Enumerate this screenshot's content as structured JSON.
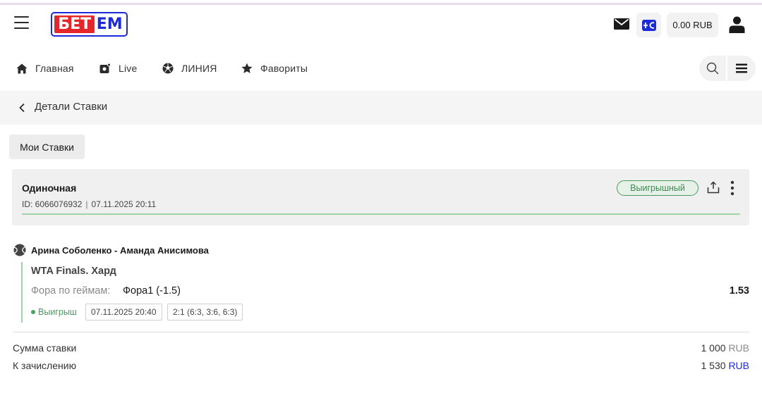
{
  "header": {
    "logo_left": "БЕТ",
    "logo_right": "ЕМ",
    "balance": "0.00 RUB"
  },
  "nav": {
    "items": [
      {
        "label": "Главная",
        "icon": "home-icon"
      },
      {
        "label": "Live",
        "icon": "live-icon"
      },
      {
        "label": "ЛИНИЯ",
        "icon": "soccer-ball-icon"
      },
      {
        "label": "Фавориты",
        "icon": "star-icon"
      }
    ]
  },
  "subheader": {
    "title": "Детали Ставки"
  },
  "my_bets_label": "Мои Ставки",
  "bet": {
    "type": "Одиночная",
    "id_text": "ID: 6066076932",
    "datetime": "07.11.2025 20:11",
    "status": "Выигрышный",
    "status_color": "#3f8a52"
  },
  "event": {
    "sport_icon": "tennis-ball-icon",
    "title": "Арина Соболенко - Аманда Анисимова",
    "tournament": "WTA Finals. Хард",
    "market_label": "Фора по геймам:",
    "market_value": "Фора1 (-1.5)",
    "odds": "1.53",
    "result": "Выигрыш",
    "event_datetime": "07.11.2025 20:40",
    "score": "2:1 (6:3, 3:6, 6:3)"
  },
  "summary": {
    "stake_label": "Сумма ставки",
    "stake_amount": "1 000",
    "stake_currency": "RUB",
    "payout_label": "К зачислению",
    "payout_amount": "1 530",
    "payout_currency": "RUB"
  },
  "colors": {
    "brand_red": "#e5262b",
    "brand_blue": "#1d2ad8",
    "win_green": "#4a9a5e"
  }
}
